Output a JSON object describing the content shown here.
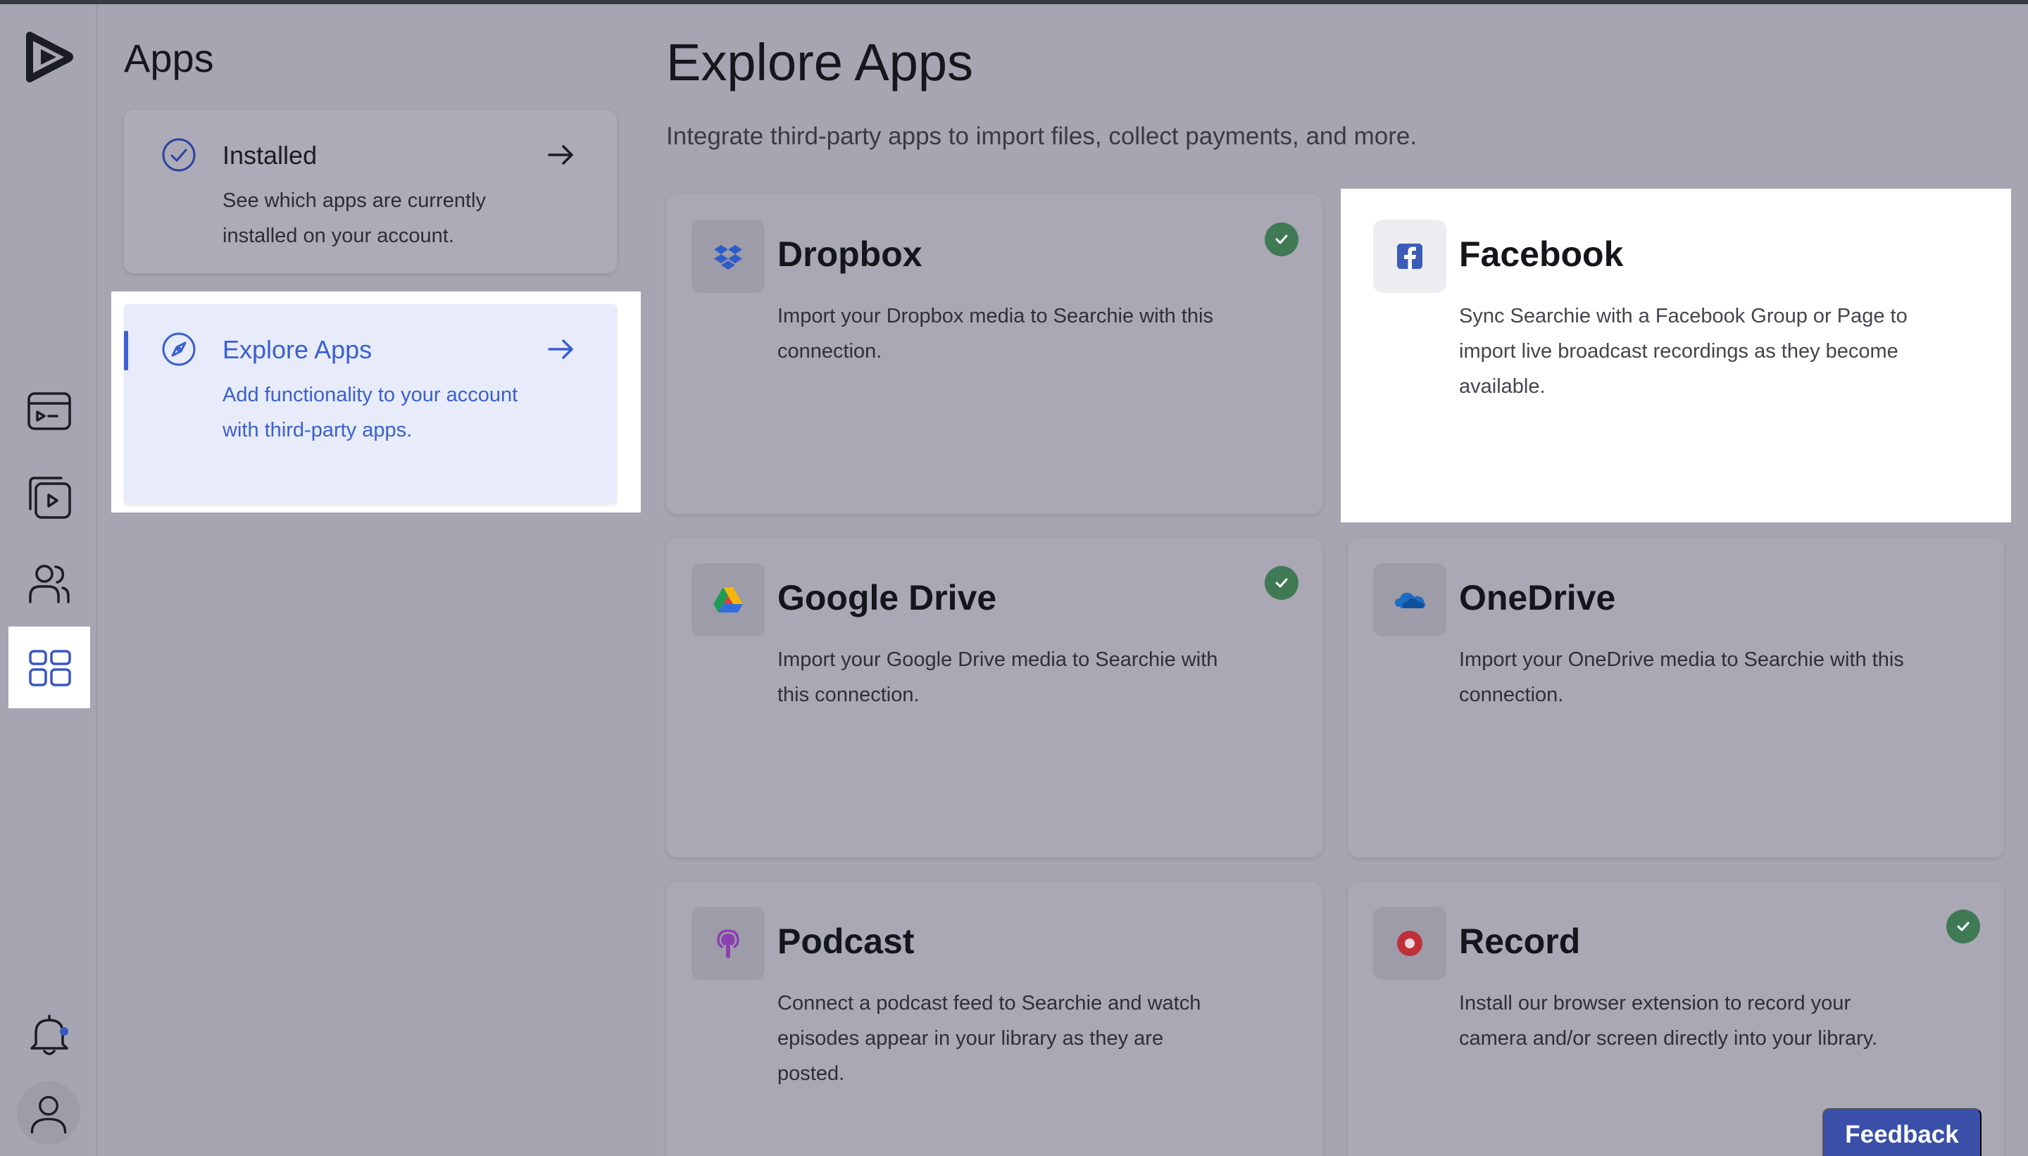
{
  "sidebar": {
    "items": [
      {
        "icon": "logo-icon"
      },
      {
        "icon": "media-console-icon"
      },
      {
        "icon": "video-library-icon"
      },
      {
        "icon": "users-icon"
      },
      {
        "icon": "apps-grid-icon",
        "active": true
      },
      {
        "icon": "notification-bell-icon"
      },
      {
        "icon": "user-avatar-icon"
      }
    ]
  },
  "panel": {
    "title": "Apps",
    "items": [
      {
        "label": "Installed",
        "description": "See which apps are currently installed on your account.",
        "icon": "check-circle-icon"
      },
      {
        "label": "Explore Apps",
        "description": "Add functionality to your account with third-party apps.",
        "icon": "compass-icon",
        "active": true
      }
    ]
  },
  "main": {
    "title": "Explore Apps",
    "subtitle": "Integrate third-party apps to import files, collect payments, and more.",
    "apps": [
      {
        "name": "Dropbox",
        "description": "Import your Dropbox media to Searchie with this connection.",
        "installed": true,
        "icon": "dropbox-icon",
        "color": "#2f5cc9"
      },
      {
        "name": "Facebook",
        "description": "Sync Searchie with a Facebook Group or Page to import live broadcast recordings as they become available.",
        "installed": false,
        "icon": "facebook-icon",
        "color": "#3b5cb8"
      },
      {
        "name": "Google Drive",
        "description": "Import your Google Drive media to Searchie with this connection.",
        "installed": true,
        "icon": "google-drive-icon"
      },
      {
        "name": "OneDrive",
        "description": "Import your OneDrive media to Searchie with this connection.",
        "installed": false,
        "icon": "onedrive-icon",
        "color": "#1d6bc0"
      },
      {
        "name": "Podcast",
        "description": "Connect a podcast feed to Searchie and watch episodes appear in your library as they are posted.",
        "installed": false,
        "icon": "podcast-icon",
        "color": "#8b3fb0"
      },
      {
        "name": "Record",
        "description": "Install our browser extension to record your camera and/or screen directly into your library.",
        "installed": true,
        "icon": "record-icon",
        "color": "#c0303a"
      }
    ]
  },
  "feedback": {
    "label": "Feedback"
  },
  "colors": {
    "accent": "#3b5fcf",
    "check": "#3f7a55",
    "feedback": "#3a4fa8"
  }
}
